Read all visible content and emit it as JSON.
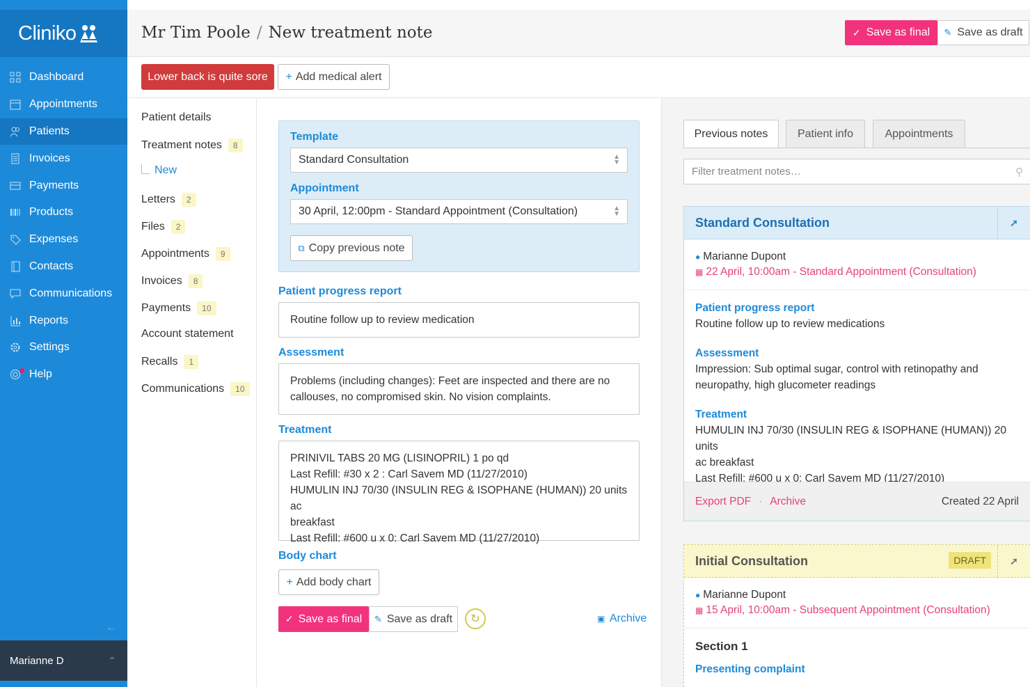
{
  "app": {
    "name": "Cliniko"
  },
  "sidebar": {
    "items": [
      {
        "label": "Dashboard",
        "icon": "dashboard-icon"
      },
      {
        "label": "Appointments",
        "icon": "calendar-icon"
      },
      {
        "label": "Patients",
        "icon": "patients-icon",
        "active": true
      },
      {
        "label": "Invoices",
        "icon": "invoice-icon"
      },
      {
        "label": "Payments",
        "icon": "payment-icon"
      },
      {
        "label": "Products",
        "icon": "barcode-icon"
      },
      {
        "label": "Expenses",
        "icon": "tag-icon"
      },
      {
        "label": "Contacts",
        "icon": "contacts-icon"
      },
      {
        "label": "Communications",
        "icon": "chat-icon"
      },
      {
        "label": "Reports",
        "icon": "chart-icon"
      },
      {
        "label": "Settings",
        "icon": "gear-icon"
      },
      {
        "label": "Help",
        "icon": "help-icon"
      }
    ],
    "user": "Marianne D"
  },
  "header": {
    "patient": "Mr Tim Poole",
    "separator": "/",
    "page": "New treatment note",
    "save_final": "Save as final",
    "save_draft": "Save as draft"
  },
  "alerts": {
    "alert": "Lower back is quite sore",
    "add_alert": "Add medical alert"
  },
  "subnav": {
    "items": [
      {
        "label": "Patient details",
        "count": ""
      },
      {
        "label": "Treatment notes",
        "count": "8"
      },
      {
        "label": "Letters",
        "count": "2"
      },
      {
        "label": "Files",
        "count": "2"
      },
      {
        "label": "Appointments",
        "count": "9"
      },
      {
        "label": "Invoices",
        "count": "8"
      },
      {
        "label": "Payments",
        "count": "10"
      },
      {
        "label": "Account statement",
        "count": ""
      },
      {
        "label": "Recalls",
        "count": "1"
      },
      {
        "label": "Communications",
        "count": "10"
      }
    ],
    "new_label": "New"
  },
  "form": {
    "template_label": "Template",
    "template_value": "Standard Consultation",
    "appointment_label": "Appointment",
    "appointment_value": "30 April, 12:00pm - Standard Appointment (Consultation)",
    "copy_previous": "Copy previous note",
    "progress_label": "Patient progress report",
    "progress_value": "Routine follow up to review medication",
    "assessment_label": "Assessment",
    "assessment_lines": [
      "Problems (including changes): Feet are inspected and there are no",
      "callouses, no compromised skin. No vision complaints."
    ],
    "treatment_label": "Treatment",
    "treatment_lines": [
      "PRINIVIL TABS 20 MG (LISINOPRIL) 1 po qd",
      "Last Refill: #30 x 2 : Carl Savem MD (11/27/2010)",
      "HUMULIN INJ 70/30 (INSULIN REG & ISOPHANE (HUMAN)) 20 units ac",
      "breakfast",
      "Last Refill: #600 u x 0: Carl Savem MD (11/27/2010)"
    ],
    "body_chart_label": "Body chart",
    "add_body_chart": "Add body chart",
    "save_final": "Save as final",
    "save_draft": "Save as draft",
    "archive": "Archive"
  },
  "panel": {
    "tabs": [
      "Previous notes",
      "Patient info",
      "Appointments"
    ],
    "filter_placeholder": "Filter treatment notes…",
    "note1": {
      "title": "Standard Consultation",
      "practitioner": "Marianne Dupont",
      "appointment": "22 April, 10:00am - Standard Appointment (Consultation)",
      "progress_label": "Patient progress report",
      "progress_value": "Routine follow up to review medications",
      "assessment_label": "Assessment",
      "assessment_lines": [
        "Impression: Sub optimal sugar, control with retinopathy and",
        "neuropathy, high glucometer readings"
      ],
      "treatment_label": "Treatment",
      "treatment_lines": [
        "HUMULIN INJ 70/30 (INSULIN REG & ISOPHANE (HUMAN)) 20 units",
        "ac breakfast",
        "Last Refill: #600 u x 0: Carl Savem MD (11/27/2010)"
      ],
      "export": "Export PDF",
      "dot": "·",
      "archive": "Archive",
      "created": "Created 22 April"
    },
    "note2": {
      "title": "Initial Consultation",
      "badge": "DRAFT",
      "practitioner": "Marianne Dupont",
      "appointment": "15 April, 10:00am - Subsequent Appointment (Consultation)",
      "section": "Section 1",
      "sub_label": "Presenting complaint"
    }
  }
}
